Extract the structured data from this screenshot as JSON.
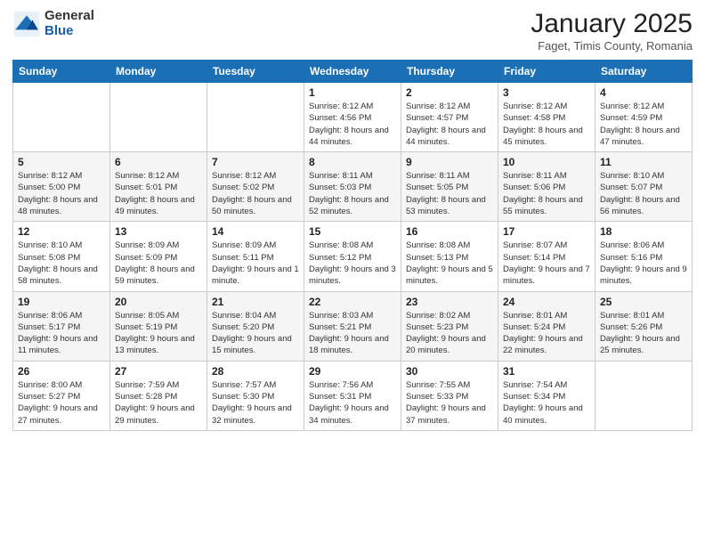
{
  "logo": {
    "general": "General",
    "blue": "Blue"
  },
  "header": {
    "title": "January 2025",
    "location": "Faget, Timis County, Romania"
  },
  "weekdays": [
    "Sunday",
    "Monday",
    "Tuesday",
    "Wednesday",
    "Thursday",
    "Friday",
    "Saturday"
  ],
  "weeks": [
    [
      {
        "day": "",
        "info": ""
      },
      {
        "day": "",
        "info": ""
      },
      {
        "day": "",
        "info": ""
      },
      {
        "day": "1",
        "info": "Sunrise: 8:12 AM\nSunset: 4:56 PM\nDaylight: 8 hours\nand 44 minutes."
      },
      {
        "day": "2",
        "info": "Sunrise: 8:12 AM\nSunset: 4:57 PM\nDaylight: 8 hours\nand 44 minutes."
      },
      {
        "day": "3",
        "info": "Sunrise: 8:12 AM\nSunset: 4:58 PM\nDaylight: 8 hours\nand 45 minutes."
      },
      {
        "day": "4",
        "info": "Sunrise: 8:12 AM\nSunset: 4:59 PM\nDaylight: 8 hours\nand 47 minutes."
      }
    ],
    [
      {
        "day": "5",
        "info": "Sunrise: 8:12 AM\nSunset: 5:00 PM\nDaylight: 8 hours\nand 48 minutes."
      },
      {
        "day": "6",
        "info": "Sunrise: 8:12 AM\nSunset: 5:01 PM\nDaylight: 8 hours\nand 49 minutes."
      },
      {
        "day": "7",
        "info": "Sunrise: 8:12 AM\nSunset: 5:02 PM\nDaylight: 8 hours\nand 50 minutes."
      },
      {
        "day": "8",
        "info": "Sunrise: 8:11 AM\nSunset: 5:03 PM\nDaylight: 8 hours\nand 52 minutes."
      },
      {
        "day": "9",
        "info": "Sunrise: 8:11 AM\nSunset: 5:05 PM\nDaylight: 8 hours\nand 53 minutes."
      },
      {
        "day": "10",
        "info": "Sunrise: 8:11 AM\nSunset: 5:06 PM\nDaylight: 8 hours\nand 55 minutes."
      },
      {
        "day": "11",
        "info": "Sunrise: 8:10 AM\nSunset: 5:07 PM\nDaylight: 8 hours\nand 56 minutes."
      }
    ],
    [
      {
        "day": "12",
        "info": "Sunrise: 8:10 AM\nSunset: 5:08 PM\nDaylight: 8 hours\nand 58 minutes."
      },
      {
        "day": "13",
        "info": "Sunrise: 8:09 AM\nSunset: 5:09 PM\nDaylight: 8 hours\nand 59 minutes."
      },
      {
        "day": "14",
        "info": "Sunrise: 8:09 AM\nSunset: 5:11 PM\nDaylight: 9 hours\nand 1 minute."
      },
      {
        "day": "15",
        "info": "Sunrise: 8:08 AM\nSunset: 5:12 PM\nDaylight: 9 hours\nand 3 minutes."
      },
      {
        "day": "16",
        "info": "Sunrise: 8:08 AM\nSunset: 5:13 PM\nDaylight: 9 hours\nand 5 minutes."
      },
      {
        "day": "17",
        "info": "Sunrise: 8:07 AM\nSunset: 5:14 PM\nDaylight: 9 hours\nand 7 minutes."
      },
      {
        "day": "18",
        "info": "Sunrise: 8:06 AM\nSunset: 5:16 PM\nDaylight: 9 hours\nand 9 minutes."
      }
    ],
    [
      {
        "day": "19",
        "info": "Sunrise: 8:06 AM\nSunset: 5:17 PM\nDaylight: 9 hours\nand 11 minutes."
      },
      {
        "day": "20",
        "info": "Sunrise: 8:05 AM\nSunset: 5:19 PM\nDaylight: 9 hours\nand 13 minutes."
      },
      {
        "day": "21",
        "info": "Sunrise: 8:04 AM\nSunset: 5:20 PM\nDaylight: 9 hours\nand 15 minutes."
      },
      {
        "day": "22",
        "info": "Sunrise: 8:03 AM\nSunset: 5:21 PM\nDaylight: 9 hours\nand 18 minutes."
      },
      {
        "day": "23",
        "info": "Sunrise: 8:02 AM\nSunset: 5:23 PM\nDaylight: 9 hours\nand 20 minutes."
      },
      {
        "day": "24",
        "info": "Sunrise: 8:01 AM\nSunset: 5:24 PM\nDaylight: 9 hours\nand 22 minutes."
      },
      {
        "day": "25",
        "info": "Sunrise: 8:01 AM\nSunset: 5:26 PM\nDaylight: 9 hours\nand 25 minutes."
      }
    ],
    [
      {
        "day": "26",
        "info": "Sunrise: 8:00 AM\nSunset: 5:27 PM\nDaylight: 9 hours\nand 27 minutes."
      },
      {
        "day": "27",
        "info": "Sunrise: 7:59 AM\nSunset: 5:28 PM\nDaylight: 9 hours\nand 29 minutes."
      },
      {
        "day": "28",
        "info": "Sunrise: 7:57 AM\nSunset: 5:30 PM\nDaylight: 9 hours\nand 32 minutes."
      },
      {
        "day": "29",
        "info": "Sunrise: 7:56 AM\nSunset: 5:31 PM\nDaylight: 9 hours\nand 34 minutes."
      },
      {
        "day": "30",
        "info": "Sunrise: 7:55 AM\nSunset: 5:33 PM\nDaylight: 9 hours\nand 37 minutes."
      },
      {
        "day": "31",
        "info": "Sunrise: 7:54 AM\nSunset: 5:34 PM\nDaylight: 9 hours\nand 40 minutes."
      },
      {
        "day": "",
        "info": ""
      }
    ]
  ]
}
